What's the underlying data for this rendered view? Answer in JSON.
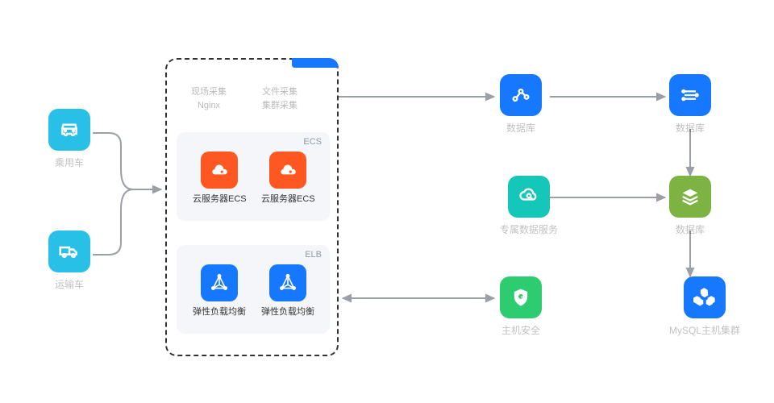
{
  "left": {
    "car": {
      "label": "乘用车",
      "color": "#29c0e7"
    },
    "truck": {
      "label": "运输车",
      "color": "#29c0e7"
    }
  },
  "center": {
    "text1_line1": "现场采集",
    "text1_line2": "Nginx",
    "text2_line1": "文件采集",
    "text2_line2": "集群采集",
    "ecs": {
      "tag": "ECS",
      "item1": "云服务器ECS",
      "item2": "云服务器ECS"
    },
    "elb": {
      "tag": "ELB",
      "item1": "弹性负载均衡",
      "item2": "弹性负载均衡"
    }
  },
  "right": {
    "analytics": {
      "label": "数据库"
    },
    "stream": {
      "label": "数据库"
    },
    "cloud_search": {
      "label": "专属数据服务"
    },
    "layers": {
      "label": "数据库"
    },
    "shield": {
      "label": "主机安全"
    },
    "cluster": {
      "label": "MySQL主机集群"
    }
  },
  "arrows": {
    "stroke": "#9aa0a6"
  }
}
